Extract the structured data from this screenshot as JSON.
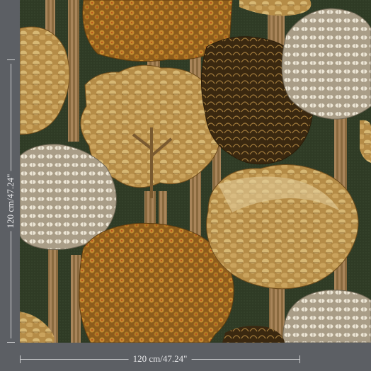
{
  "dimensions": {
    "height_label": "120 cm/47.24\"",
    "width_label": "120 cm/47.24\""
  },
  "colors": {
    "background": "#5c5f64",
    "pattern_ground": "#2f3b25",
    "golden_leaf": "#c9a35a",
    "ochre_leaf": "#a8741e",
    "cream_leaf": "#e3d9c4",
    "dark_leaf": "#4a3316",
    "trunk": "#8a6a3f"
  }
}
